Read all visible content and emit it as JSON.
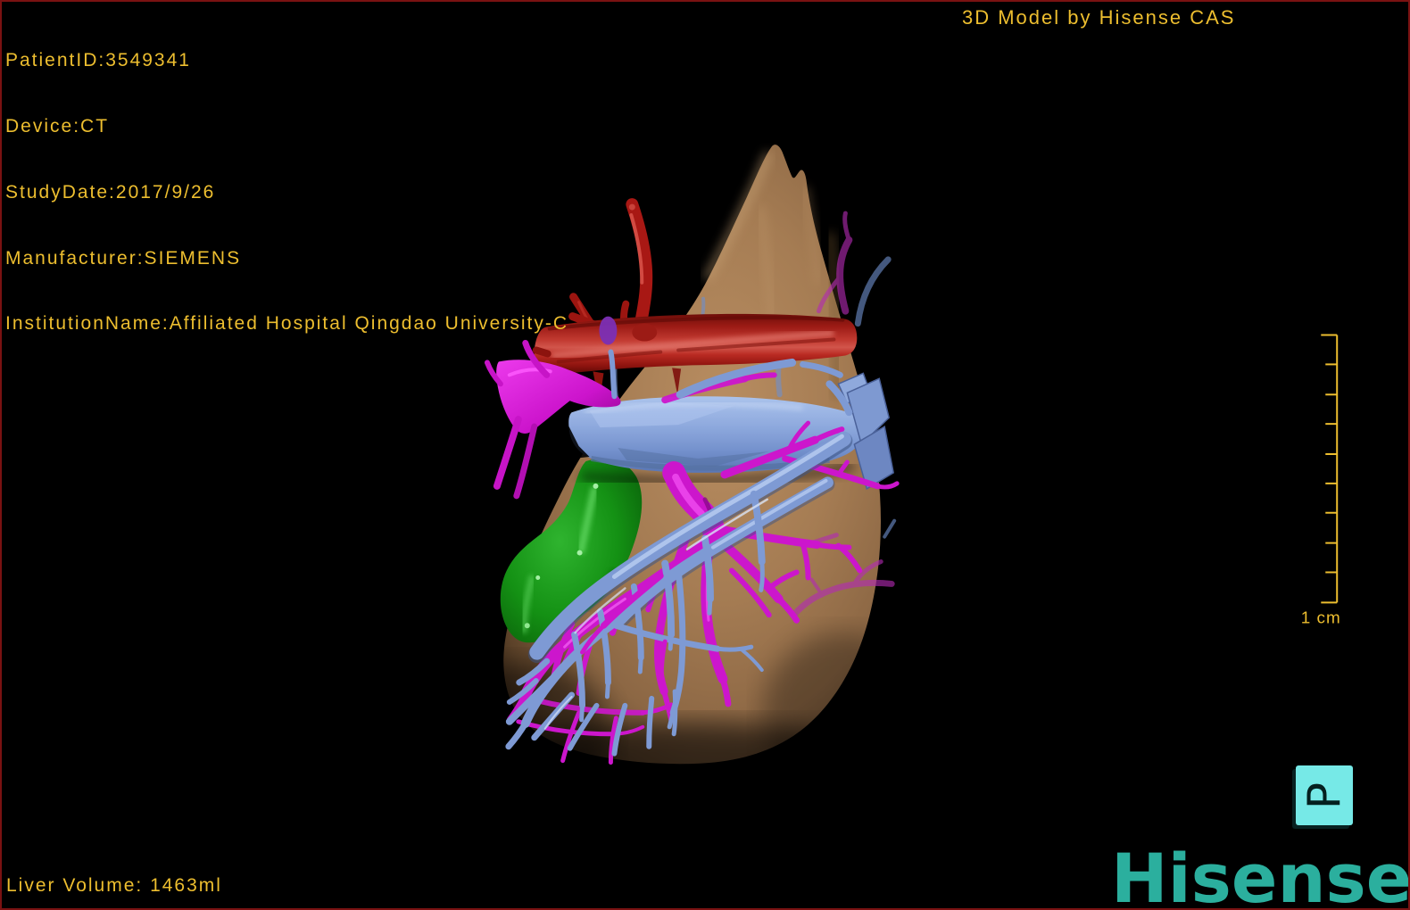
{
  "hud": {
    "patient_lines": [
      "PatientID:3549341",
      "Device:CT",
      "StudyDate:2017/9/26",
      "Manufacturer:SIEMENS",
      "InstitutionName:Affiliated Hospital Qingdao University-C"
    ],
    "watermark": "3D Model by Hisense CAS",
    "liver_volume": "Liver Volume: 1463ml",
    "scale": {
      "label": "1 cm",
      "tick_count": 10
    },
    "orientation_marker": "P"
  },
  "branding": {
    "logo_text": "Hisense"
  },
  "palette": {
    "hud_text": "#EDBE2F",
    "frame_border": "#7A1212",
    "background": "#000000",
    "liver_surface": "#A67E55",
    "hepatic_artery_red": "#B42420",
    "portal_vein_magenta": "#D916D9",
    "hepatic_vein_blue": "#8FAADE",
    "gallbladder_green": "#149114",
    "orientation_cube_cyan": "#76E9E7",
    "logo_teal": "#2BAF9E"
  }
}
